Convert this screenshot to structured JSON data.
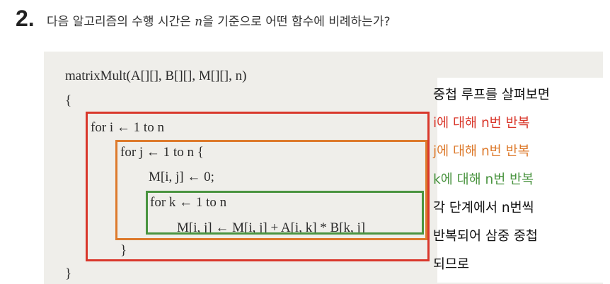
{
  "question": {
    "number": "2.",
    "text_before": "다음 알고리즘의 수행 시간은 ",
    "variable": "n",
    "text_after": "을 기준으로 어떤 함수에 비례하는가?"
  },
  "code_lines": [
    "matrixMult(A[][], B[][], M[][], n)",
    "{",
    "for i ← 1 to n",
    "for j ← 1 to n {",
    "M[i, j] ← 0;",
    "for k ← 1 to n",
    "M[i, j] ← M[i, j] + A[i, k] * B[k, j]",
    "}",
    "}"
  ],
  "annotations": [
    "중첩 루프를 살펴보면",
    "i에 대해 n번 반복",
    "j에 대해 n번 반복",
    "k에 대해 n번 반복",
    "각 단계에서 n번씩",
    "반복되어 삼중 중첩",
    "되므로"
  ],
  "colors": {
    "red": "#d9372b",
    "orange": "#dd7a2c",
    "green": "#4a9440",
    "text": "#111111"
  }
}
